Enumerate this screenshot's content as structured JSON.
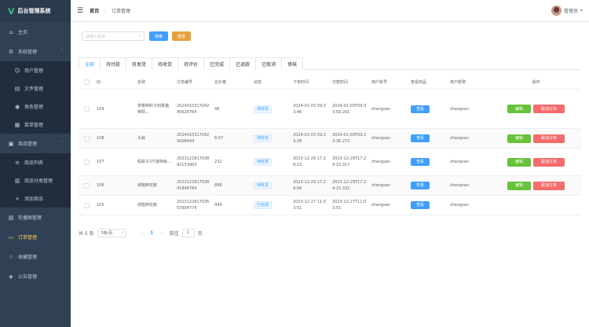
{
  "app": {
    "logo_mark": "V",
    "title": "后台管理系统"
  },
  "sidebar": {
    "items": [
      {
        "label": "主页",
        "icon": "home-icon",
        "type": "top"
      },
      {
        "label": "系统管理",
        "icon": "setting-icon",
        "type": "group"
      },
      {
        "label": "用户管理",
        "icon": "user-icon",
        "type": "sub"
      },
      {
        "label": "文件管理",
        "icon": "document-icon",
        "type": "sub"
      },
      {
        "label": "角色管理",
        "icon": "user-role-icon",
        "type": "sub"
      },
      {
        "label": "菜单管理",
        "icon": "menu-icon",
        "type": "sub"
      },
      {
        "label": "商品管理",
        "icon": "goods-icon",
        "type": "group"
      },
      {
        "label": "商品列表",
        "icon": "list-icon",
        "type": "sub"
      },
      {
        "label": "商品分类管理",
        "icon": "category-icon",
        "type": "sub"
      },
      {
        "label": "添加商品",
        "icon": "add-icon",
        "type": "sub"
      },
      {
        "label": "轮播图管理",
        "icon": "picture-icon",
        "type": "top"
      },
      {
        "label": "订单管理",
        "icon": "order-icon",
        "type": "top",
        "active": true
      },
      {
        "label": "收藏管理",
        "icon": "star-icon",
        "type": "top"
      },
      {
        "label": "公告管理",
        "icon": "notice-icon",
        "type": "top"
      }
    ]
  },
  "header": {
    "breadcrumb_home": "首页",
    "breadcrumb_sep": "/",
    "breadcrumb_current": "订单管理",
    "user_name": "管理员"
  },
  "toolbar": {
    "search_placeholder": "请输入名称",
    "query_label": "搜索",
    "reset_label": "重置"
  },
  "tabs": [
    "全部",
    "待付款",
    "待发货",
    "待收货",
    "待评价",
    "已完成",
    "已退款",
    "已取消",
    "审核"
  ],
  "table": {
    "headers": [
      "ID",
      "名称",
      "订单编号",
      "总价格",
      "状态",
      "下单时间",
      "付款时间",
      "用户账号",
      "查看商品",
      "用户昵称",
      "操作"
    ],
    "rows": [
      {
        "id": "109",
        "name": "草莓种籽子四季播种阳...",
        "order_no": "2024010317042 45626764",
        "price": "48",
        "status": "待收货",
        "order_time": "2024-01-03 09:3 3:46",
        "pay_time": "2024-01-03T09:3 3:59.201",
        "account": "zhangsan",
        "view": "查看",
        "nickname": "zhangsan",
        "edit": "编辑",
        "cancel": "取消订单",
        "height": 50
      },
      {
        "id": "108",
        "name": "大蒜",
        "order_no": "2024010317042 5008044",
        "price": "8.07",
        "status": "待收货",
        "order_time": "2024-01-03 09:2 3:28",
        "pay_time": "2024-01-03T09:2 3:36.272",
        "account": "zhangsan",
        "view": "查看",
        "nickname": "zhangsan",
        "edit": "编辑",
        "cancel": "取消订单",
        "height": 25
      },
      {
        "id": "107",
        "name": "蚂蚁子2斤装特级...",
        "order_no": "2023122917038 42153903",
        "price": "232",
        "status": "待收货",
        "order_time": "2023-12-29 17:2 9:13",
        "pay_time": "2023-12-29T17:2 9:15.317",
        "account": "zhangsan",
        "view": "查看",
        "nickname": "zhangsan",
        "edit": "编辑",
        "cancel": "取消订单",
        "height": 35
      },
      {
        "id": "106",
        "name": "绿植西花鹅",
        "order_no": "2023122917038 41846784",
        "price": "898",
        "status": "待收货",
        "order_time": "2023-12-29 17:2 4:06",
        "pay_time": "2023-12-29T17:2 4:15.332",
        "account": "zhangsan",
        "view": "查看",
        "nickname": "zhangsan",
        "edit": "编辑",
        "cancel": "取消订单",
        "height": 25
      },
      {
        "id": "105",
        "name": "绿植西花鹅",
        "order_no": "2023122917036 53904774",
        "price": "449",
        "status": "已完成",
        "order_time": "2023-12-27 11:0 3:51",
        "pay_time": "2023-12-27T11:0 3:51",
        "account": "zhangsan",
        "view": "查看",
        "nickname": "zhangsan",
        "edit": "",
        "cancel": "",
        "height": 25
      }
    ]
  },
  "pagination": {
    "total": "共 5 条",
    "page_size": "5条/页",
    "current": "1",
    "goto_label": "前往",
    "goto_value": "1",
    "page_unit": "页"
  }
}
